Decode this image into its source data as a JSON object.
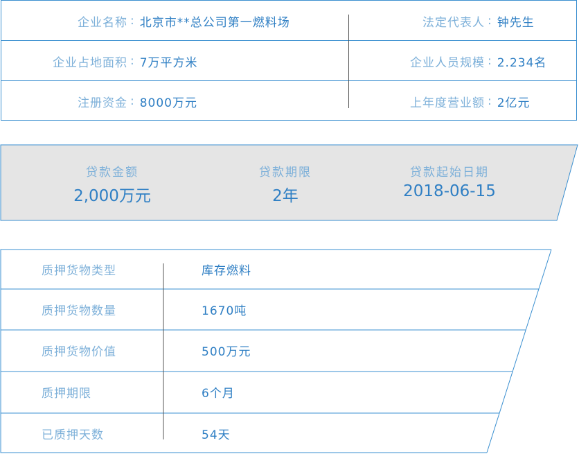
{
  "company": {
    "rows": [
      {
        "left": {
          "label": "企业名称",
          "value": "北京市**总公司第一燃料场"
        },
        "right": {
          "label": "法定代表人",
          "value": "钟先生"
        }
      },
      {
        "left": {
          "label": "企业占地面积",
          "value": "7万平方米"
        },
        "right": {
          "label": "企业人员规模",
          "value": "2.234名"
        }
      },
      {
        "left": {
          "label": "注册资金",
          "value": "8000万元"
        },
        "right": {
          "label": "上年度营业额",
          "value": "2亿元"
        }
      }
    ],
    "colon": ":"
  },
  "loan": {
    "amount_label": "贷款金额",
    "amount_value": "2,000万元",
    "term_label": "贷款期限",
    "term_value": "2年",
    "start_label": "贷款起始日期",
    "start_value": "2018-06-15"
  },
  "pledge": {
    "rows": [
      {
        "label": "质押货物类型",
        "value": "库存燃料"
      },
      {
        "label": "质押货物数量",
        "value": "1670吨"
      },
      {
        "label": "质押货物价值",
        "value": "500万元"
      },
      {
        "label": "质押期限",
        "value": "6个月"
      },
      {
        "label": "已质押天数",
        "value": "54天"
      }
    ]
  },
  "colors": {
    "border": "#3a8fd0",
    "label": "#7db0d9",
    "value": "#2f7fc4",
    "banner_bg": "#e5e5e5"
  }
}
